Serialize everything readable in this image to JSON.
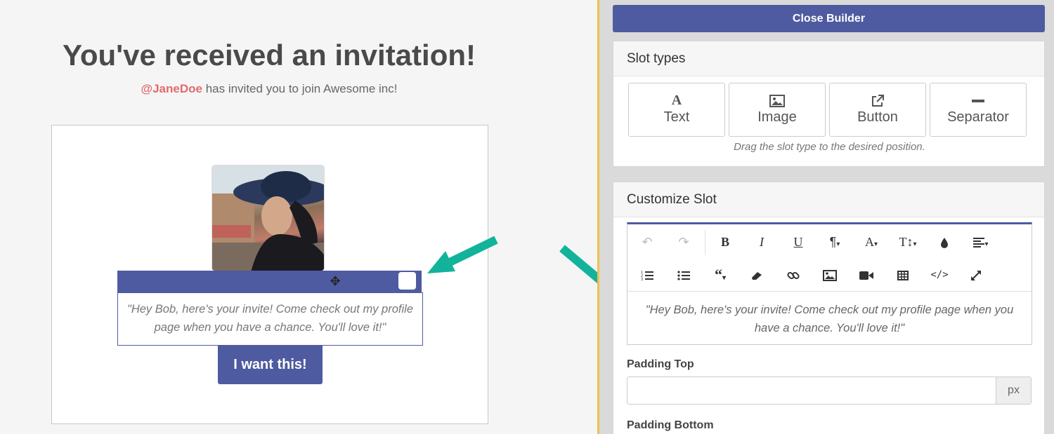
{
  "preview": {
    "title": "You've received an invitation!",
    "mention": "@JaneDoe",
    "subtitle_rest": " has invited you to join Awesome inc!",
    "quote": "\"Hey Bob, here's your invite! Come check out my profile page when you have a chance. You'll love it!\"",
    "cta_label": "I want this!"
  },
  "builder": {
    "close_label": "Close Builder",
    "slot_types": {
      "heading": "Slot types",
      "items": [
        {
          "label": "Text",
          "icon": "text-icon"
        },
        {
          "label": "Image",
          "icon": "image-icon"
        },
        {
          "label": "Button",
          "icon": "external-link-icon"
        },
        {
          "label": "Separator",
          "icon": "minus-icon"
        }
      ],
      "hint": "Drag the slot type to the desired position."
    },
    "customize": {
      "heading": "Customize Slot",
      "editor_content": "\"Hey Bob, here's your invite! Come check out my profile page when you have a chance. You'll love it!\"",
      "padding_top_label": "Padding Top",
      "padding_top_value": "",
      "padding_unit": "px",
      "padding_bottom_label": "Padding Bottom"
    }
  },
  "colors": {
    "accent": "#4e5ba0",
    "arrow": "#12b39b",
    "divider": "#f0c14b",
    "mention": "#e06c6c"
  }
}
